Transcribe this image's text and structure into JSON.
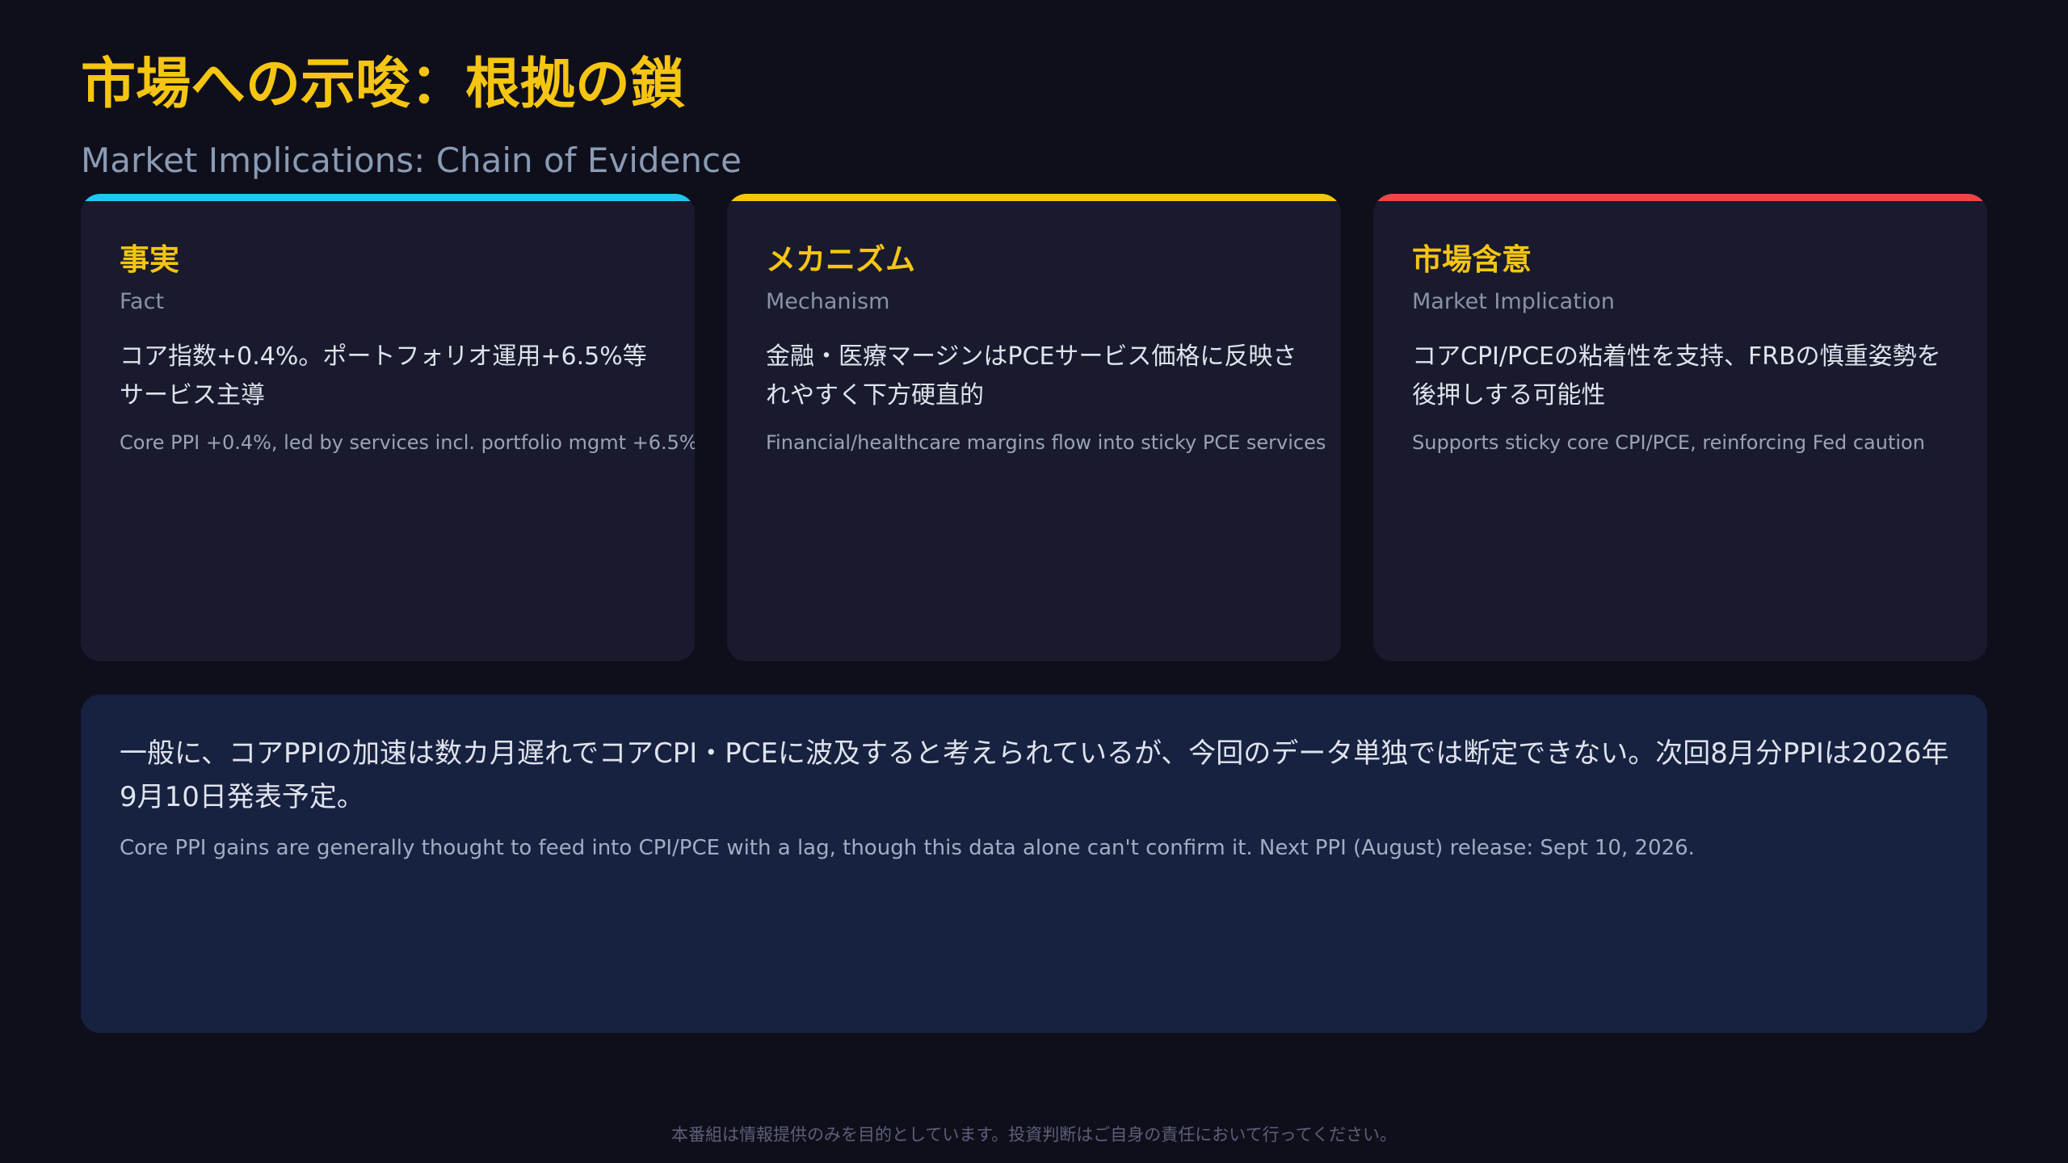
{
  "header": {
    "title_jp": "市場への示唆：根拠の鎖",
    "title_en": "Market Implications: Chain of Evidence"
  },
  "colors": {
    "accent_yellow": "#f5c511",
    "fact_bar": "#1ec8f0",
    "mechanism_bar": "#f5c511",
    "implication_bar": "#ee4545"
  },
  "cards": [
    {
      "title": "事実",
      "subtitle": "Fact",
      "body": "コア指数+0.4%。ポートフォリオ運用+6.5%等サービス主導",
      "note": "Core PPI +0.4%, led by services incl. portfolio mgmt +6.5%"
    },
    {
      "title": "メカニズム",
      "subtitle": "Mechanism",
      "body": "金融・医療マージンはPCEサービス価格に反映されやすく下方硬直的",
      "note": "Financial/healthcare margins flow into sticky PCE services"
    },
    {
      "title": "市場含意",
      "subtitle": "Market Implication",
      "body": "コアCPI/PCEの粘着性を支持、FRBの慎重姿勢を後押しする可能性",
      "note": "Supports sticky core CPI/PCE, reinforcing Fed caution"
    }
  ],
  "summary": {
    "body": "一般に、コアPPIの加速は数カ月遅れでコアCPI・PCEに波及すると考えられているが、今回のデータ単独では断定できない。次回8月分PPIは2026年9月10日発表予定。",
    "note": "Core PPI gains are generally thought to feed into CPI/PCE with a lag, though this data alone can't confirm it. Next PPI (August) release: Sept 10, 2026."
  },
  "footer": {
    "disclaimer": "本番組は情報提供のみを目的としています。投資判断はご自身の責任において行ってください。"
  }
}
